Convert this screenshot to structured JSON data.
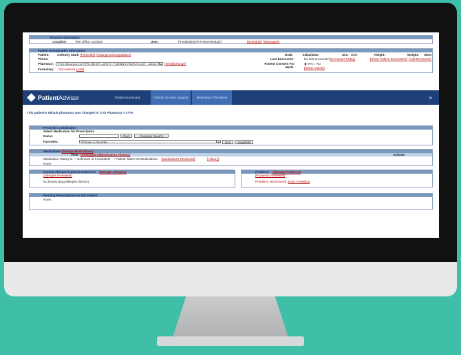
{
  "practice": {
    "header": "Practice Information",
    "location_label": "Location:",
    "location": "Test Office Location",
    "user_label": "User:",
    "user": "ProviderjZujYR PartnerWqUpjY",
    "schedule": "[Schedule]",
    "messages": "[Messages]"
  },
  "demo": {
    "header": "Patient Demographic Information",
    "patient_label": "Patient:",
    "patient": "Anthony Stark",
    "prescribe": "[Prescribe]",
    "change_demo": "[Change Demographics]",
    "phone_label": "Phone:",
    "pharmacy_label": "Pharmacy:",
    "pharmacy": "CVS Pharmacy # 2779 (R) (E) - 603 S. CHERRY GROVE AVE., ANNA...",
    "view": "[View]",
    "change": "[Change]",
    "formulary_label": "Formulary:",
    "formulary": "Not entered",
    "add": "[Add]",
    "dob_label": "DOB:",
    "dob": "04/23/2010",
    "sex_label": "Sex:",
    "sex": "Male",
    "height_label": "Height:",
    "weight_label": "Weight:",
    "bsa_label": "BSA:",
    "last_enc_label": "Last Encounter:",
    "last_enc": "No last encounter",
    "enc_today": "[Encounter Today]",
    "show_enc": "[Show Patient Encounters]",
    "add_enc": "[Add Encounter]",
    "consent_label": "Patient Consent For Meds:",
    "yes": "Yes",
    "no": "No",
    "show_activity": "[Show Activity]"
  },
  "nav": {
    "brand_a": "Patient",
    "brand_b": "Advisor",
    "tabs": [
      "Patient Scorecard",
      "Clinical Decision Support",
      "Medication Fill History"
    ],
    "arrow": "»"
  },
  "notice": "This patient's default pharmacy was changed to CVS Pharmacy # 2779.",
  "prescribe": {
    "header": "Prescribe a Medication",
    "select_label": "Select Medication for Prescription",
    "name_label": "Name:",
    "find": "Find",
    "category": "Category Search",
    "fav_label": "Favorites:",
    "fav_value": "Choose a Favorite",
    "use": "Use",
    "view_edit": "View/Edit"
  },
  "medications": {
    "header": "Medications",
    "manage": "[Manage Medications]",
    "view_label": "View:",
    "detail": "[Detail]",
    "mini": "[Mini]",
    "history_link": "[Medication History]",
    "actions": "Actions",
    "history_is": "Medication History is",
    "unknown": "Unknown or Incomplete",
    "no_meds": "Patient Takes No Medications",
    "reviewed": "[Medications Reviewed]",
    "history": "[History]",
    "none": "None."
  },
  "allergies": {
    "header": "Current Allergies/Adverse Reactions",
    "manage": "[Manage Allergies]",
    "reviewed": "[Allergies Reviewed]",
    "nkda": "No known drug allergies (NKDA)"
  },
  "problems": {
    "header": "Problems",
    "manage": "[Manage Problems]",
    "reviewed": "[Problems Reviewed]",
    "not_entered": "Problems Not Entered",
    "enter": "Enter Problems"
  },
  "pending": {
    "header": "Pending Prescriptions for this Patient",
    "none": "None."
  }
}
